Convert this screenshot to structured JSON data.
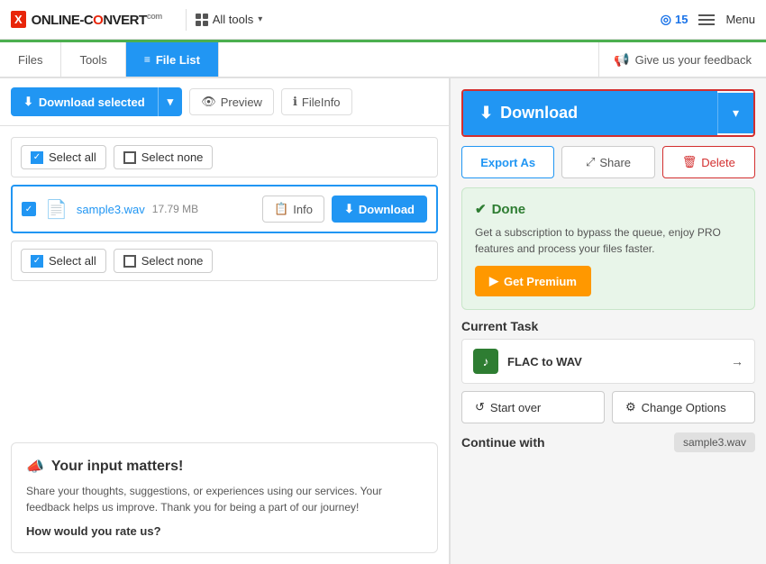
{
  "topNav": {
    "logoText": "ONLINE-CONVERT",
    "logoCom": "com",
    "allToolsLabel": "All tools",
    "coinsCount": "15",
    "menuLabel": "Menu"
  },
  "tabs": {
    "filesLabel": "Files",
    "toolsLabel": "Tools",
    "fileListLabel": "File List",
    "feedbackLabel": "Give us your feedback"
  },
  "toolbar": {
    "downloadSelectedLabel": "Download selected",
    "previewLabel": "Preview",
    "fileInfoLabel": "FileInfo"
  },
  "fileList": {
    "selectAllLabel": "Select all",
    "selectNoneLabel": "Select none",
    "selectAllLabel2": "Select all",
    "selectNoneLabel2": "Select none",
    "fileName": "sample3.wav",
    "fileSize": "17.79 MB",
    "infoLabel": "Info",
    "downloadLabel": "Download"
  },
  "feedbackBox": {
    "title": "Your input matters!",
    "description": "Share your thoughts, suggestions, or experiences using our services. Your feedback helps us improve. Thank you for being a part of our journey!",
    "question": "How would you rate us?"
  },
  "rightPanel": {
    "downloadLabel": "Download",
    "exportAsLabel": "Export As",
    "shareLabel": "Share",
    "deleteLabel": "Delete",
    "doneTitle": "Done",
    "doneDescription": "Get a subscription to bypass the queue, enjoy PRO features and process your files faster.",
    "getPremiumLabel": "Get Premium",
    "currentTaskTitle": "Current Task",
    "flacToWav": "FLAC to WAV",
    "startOverLabel": "Start over",
    "changeOptionsLabel": "Change Options",
    "continueWithLabel": "Continue with",
    "continueFileName": "sample3.wav"
  }
}
